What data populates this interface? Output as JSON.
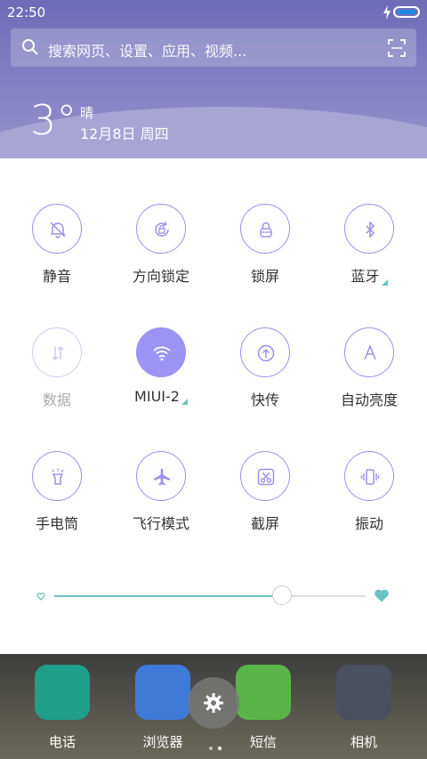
{
  "status_bar": {
    "time": "22:50"
  },
  "search": {
    "placeholder": "搜索网页、设置、应用、视频..."
  },
  "weather": {
    "temperature": "3°",
    "condition": "晴",
    "date": "12月8日 周四"
  },
  "quick_settings": {
    "tiles": [
      {
        "label": "静音",
        "icon": "bell-off-icon",
        "state": "off"
      },
      {
        "label": "方向锁定",
        "icon": "rotation-lock-icon",
        "state": "off"
      },
      {
        "label": "锁屏",
        "icon": "lock-icon",
        "state": "off"
      },
      {
        "label": "蓝牙",
        "icon": "bluetooth-icon",
        "state": "off",
        "has_menu": true
      },
      {
        "label": "数据",
        "icon": "data-arrows-icon",
        "state": "disabled"
      },
      {
        "label": "MIUI-2",
        "icon": "wifi-icon",
        "state": "on",
        "has_menu": true
      },
      {
        "label": "快传",
        "icon": "upload-icon",
        "state": "off"
      },
      {
        "label": "自动亮度",
        "icon": "auto-brightness-icon",
        "state": "off"
      },
      {
        "label": "手电筒",
        "icon": "flashlight-icon",
        "state": "off"
      },
      {
        "label": "飞行模式",
        "icon": "airplane-icon",
        "state": "off"
      },
      {
        "label": "截屏",
        "icon": "scissors-icon",
        "state": "off"
      },
      {
        "label": "振动",
        "icon": "vibrate-icon",
        "state": "off"
      }
    ],
    "brightness": {
      "level": 0.73
    }
  },
  "dock": {
    "apps": [
      {
        "label": "电话",
        "icon": "phone-icon"
      },
      {
        "label": "浏览器",
        "icon": "browser-icon"
      },
      {
        "label": "短信",
        "icon": "message-icon"
      },
      {
        "label": "相机",
        "icon": "camera-icon"
      }
    ]
  },
  "colors": {
    "accent": "#9d93f5",
    "teal": "#6cc2be",
    "header": "#7a76bf"
  }
}
